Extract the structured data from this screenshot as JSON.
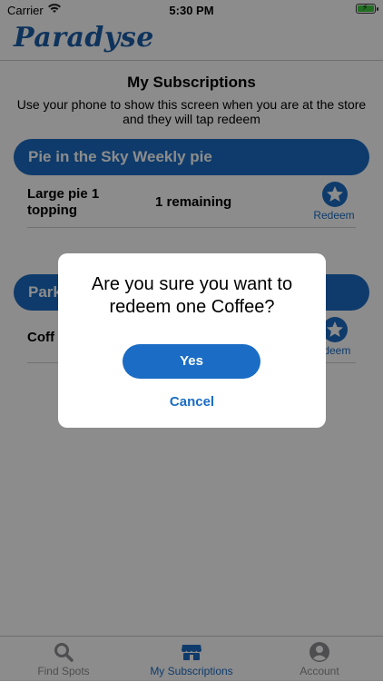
{
  "status_bar": {
    "carrier": "Carrier",
    "time": "5:30 PM"
  },
  "header": {
    "logo": "Paradyse"
  },
  "page": {
    "title": "My Subscriptions",
    "subtitle": "Use your phone to show this screen when you are at the store and they will tap redeem"
  },
  "subscriptions": [
    {
      "name": "Pie in the Sky Weekly pie",
      "item": "Large pie 1 topping",
      "remaining": "1 remaining",
      "redeem_label": "Redeem"
    },
    {
      "name": "Park",
      "item": "Coff",
      "remaining": "",
      "redeem_label": "edeem"
    }
  ],
  "dialog": {
    "message": "Are you sure you want to redeem one Coffee?",
    "yes_label": "Yes",
    "cancel_label": "Cancel"
  },
  "tabbar": {
    "items": [
      {
        "label": "Find Spots",
        "icon": "search-icon",
        "active": false
      },
      {
        "label": "My Subscriptions",
        "icon": "store-icon",
        "active": true
      },
      {
        "label": "Account",
        "icon": "account-icon",
        "active": false
      }
    ]
  },
  "colors": {
    "accent": "#1a6cc4",
    "logo": "#1a5ea8",
    "battery": "#3ec83e"
  }
}
